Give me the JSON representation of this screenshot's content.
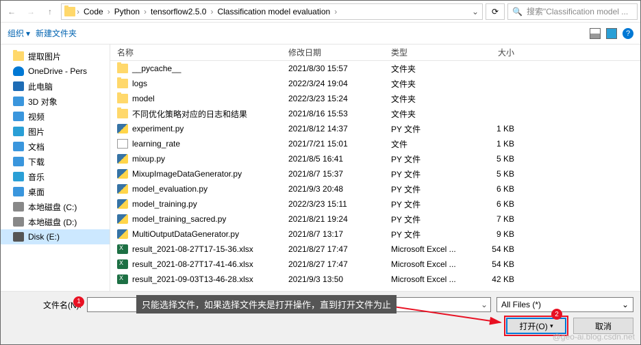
{
  "addressbar": {
    "path": [
      "Code",
      "Python",
      "tensorflow2.5.0",
      "Classification model evaluation"
    ],
    "search_placeholder": "搜索\"Classification model ..."
  },
  "toolbar": {
    "organize": "组织",
    "newfolder": "新建文件夹"
  },
  "sidebar": {
    "items": [
      {
        "icon": "folder",
        "label": "提取图片"
      },
      {
        "icon": "cloud",
        "label": "OneDrive - Pers"
      },
      {
        "icon": "pc",
        "label": "此电脑"
      },
      {
        "icon": "blue",
        "label": "3D 对象"
      },
      {
        "icon": "blue",
        "label": "视频"
      },
      {
        "icon": "pic",
        "label": "图片"
      },
      {
        "icon": "blue",
        "label": "文档"
      },
      {
        "icon": "blue",
        "label": "下载"
      },
      {
        "icon": "music",
        "label": "音乐"
      },
      {
        "icon": "blue",
        "label": "桌面"
      },
      {
        "icon": "drive",
        "label": "本地磁盘 (C:)"
      },
      {
        "icon": "drive",
        "label": "本地磁盘 (D:)"
      },
      {
        "icon": "disk",
        "label": "Disk (E:)"
      }
    ],
    "selected_index": 12
  },
  "columns": {
    "name": "名称",
    "date": "修改日期",
    "type": "类型",
    "size": "大小"
  },
  "files": [
    {
      "icon": "folder",
      "name": "__pycache__",
      "date": "2021/8/30 15:57",
      "type": "文件夹",
      "size": ""
    },
    {
      "icon": "folder",
      "name": "logs",
      "date": "2022/3/24 19:04",
      "type": "文件夹",
      "size": ""
    },
    {
      "icon": "folder",
      "name": "model",
      "date": "2022/3/23 15:24",
      "type": "文件夹",
      "size": ""
    },
    {
      "icon": "folder",
      "name": "不同优化策略对应的日志和结果",
      "date": "2021/8/16 15:53",
      "type": "文件夹",
      "size": ""
    },
    {
      "icon": "py",
      "name": "experiment.py",
      "date": "2021/8/12 14:37",
      "type": "PY 文件",
      "size": "1 KB"
    },
    {
      "icon": "file",
      "name": "learning_rate",
      "date": "2021/7/21 15:01",
      "type": "文件",
      "size": "1 KB"
    },
    {
      "icon": "py",
      "name": "mixup.py",
      "date": "2021/8/5 16:41",
      "type": "PY 文件",
      "size": "5 KB"
    },
    {
      "icon": "py",
      "name": "MixupImageDataGenerator.py",
      "date": "2021/8/7 15:37",
      "type": "PY 文件",
      "size": "5 KB"
    },
    {
      "icon": "py",
      "name": "model_evaluation.py",
      "date": "2021/9/3 20:48",
      "type": "PY 文件",
      "size": "6 KB"
    },
    {
      "icon": "py",
      "name": "model_training.py",
      "date": "2022/3/23 15:11",
      "type": "PY 文件",
      "size": "6 KB"
    },
    {
      "icon": "py",
      "name": "model_training_sacred.py",
      "date": "2021/8/21 19:24",
      "type": "PY 文件",
      "size": "7 KB"
    },
    {
      "icon": "py",
      "name": "MultiOutputDataGenerator.py",
      "date": "2021/8/7 13:17",
      "type": "PY 文件",
      "size": "9 KB"
    },
    {
      "icon": "xlsx",
      "name": "result_2021-08-27T17-15-36.xlsx",
      "date": "2021/8/27 17:47",
      "type": "Microsoft Excel ...",
      "size": "54 KB"
    },
    {
      "icon": "xlsx",
      "name": "result_2021-08-27T17-41-46.xlsx",
      "date": "2021/8/27 17:47",
      "type": "Microsoft Excel ...",
      "size": "54 KB"
    },
    {
      "icon": "xlsx",
      "name": "result_2021-09-03T13-46-28.xlsx",
      "date": "2021/9/3 13:50",
      "type": "Microsoft Excel ...",
      "size": "42 KB"
    }
  ],
  "footer": {
    "filename_label": "文件名(N):",
    "filetype": "All Files  (*)",
    "open": "打开(O)",
    "cancel": "取消",
    "badge1": "1",
    "badge2": "2",
    "tooltip": "只能选择文件，如果选择文件夹是打开操作，直到打开文件为止"
  },
  "watermark": "@geo-ai.blog.csdn.net"
}
